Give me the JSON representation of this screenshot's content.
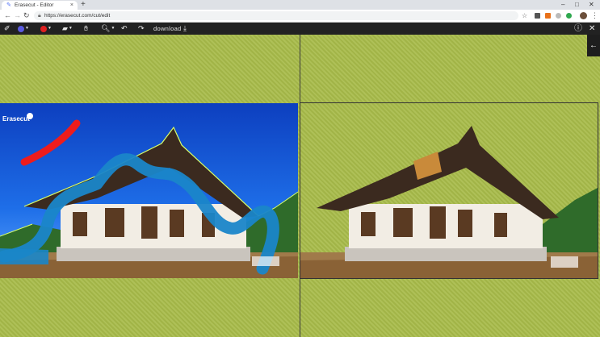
{
  "browser": {
    "tab_title": "Erasecut - Editor",
    "tab_close": "×",
    "new_tab": "+",
    "window_controls": {
      "minimize": "–",
      "maximize": "□",
      "close": "✕"
    },
    "url": "https://erasecut.com/cut/edit",
    "nav": {
      "back": "←",
      "forward": "→",
      "reload": "↻"
    }
  },
  "toolbar": {
    "download_label": "download",
    "brush_color": "#5b5be0",
    "eraser_color": "#e02020"
  },
  "icons": {
    "brush": "paint-brush-icon",
    "mark_keep": "keep-brush-icon",
    "mark_remove": "remove-brush-icon",
    "eraser": "eraser-icon",
    "hand": "hand-pan-icon",
    "zoom": "zoom-icon",
    "undo": "undo-icon",
    "redo": "redo-icon",
    "download": "download-icon",
    "help": "help-icon",
    "close": "close-icon",
    "side_toggle": "arrow-left-icon"
  },
  "colors": {
    "workspace_bg": "#a8bb4a",
    "keep_stroke": "#1a86c9",
    "remove_stroke": "#ee1c1c",
    "outline": "#d8ff6a"
  },
  "watermark": "Erasecut"
}
